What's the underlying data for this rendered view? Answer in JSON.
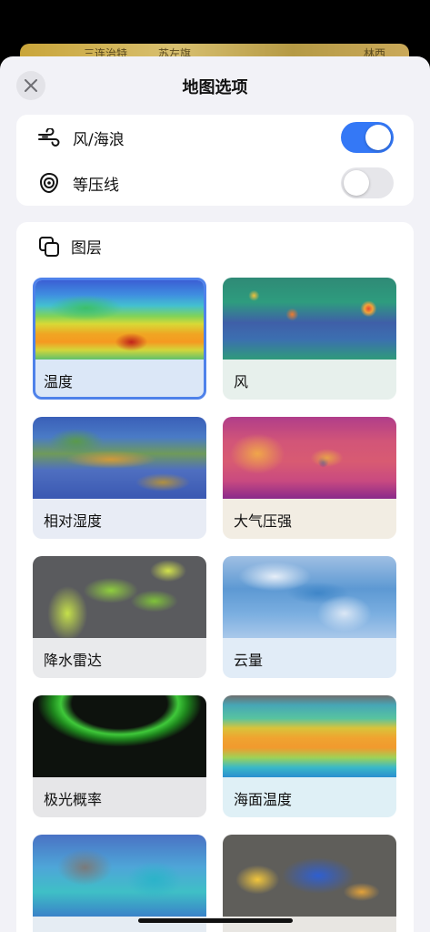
{
  "behind": {
    "left_text": "三连治特",
    "mid_text": "苏左旗",
    "right_text": "林西"
  },
  "header": {
    "title": "地图选项",
    "close_icon": "close-icon"
  },
  "options": [
    {
      "label": "风/海浪",
      "icon": "wind-icon",
      "enabled": true
    },
    {
      "label": "等压线",
      "icon": "isobar-icon",
      "enabled": false
    }
  ],
  "layers": {
    "title": "图层",
    "icon": "layers-icon",
    "items": [
      {
        "label": "温度",
        "selected": true,
        "caption_bg": "#dbe7f7"
      },
      {
        "label": "风",
        "selected": false,
        "caption_bg": "#e7f0ec"
      },
      {
        "label": "相对湿度",
        "selected": false,
        "caption_bg": "#e8ecf5"
      },
      {
        "label": "大气压强",
        "selected": false,
        "caption_bg": "#f2ede3"
      },
      {
        "label": "降水雷达",
        "selected": false,
        "caption_bg": "#e9eaec"
      },
      {
        "label": "云量",
        "selected": false,
        "caption_bg": "#e1ecf7"
      },
      {
        "label": "极光概率",
        "selected": false,
        "caption_bg": "#e6e6e8"
      },
      {
        "label": "海面温度",
        "selected": false,
        "caption_bg": "#dff0f6"
      },
      {
        "label": "",
        "selected": false,
        "caption_bg": "#e5ecf3"
      },
      {
        "label": "",
        "selected": false,
        "caption_bg": "#e8e6e2"
      }
    ]
  },
  "colors": {
    "accent": "#3478f6",
    "selection_border": "#4f82ea"
  }
}
